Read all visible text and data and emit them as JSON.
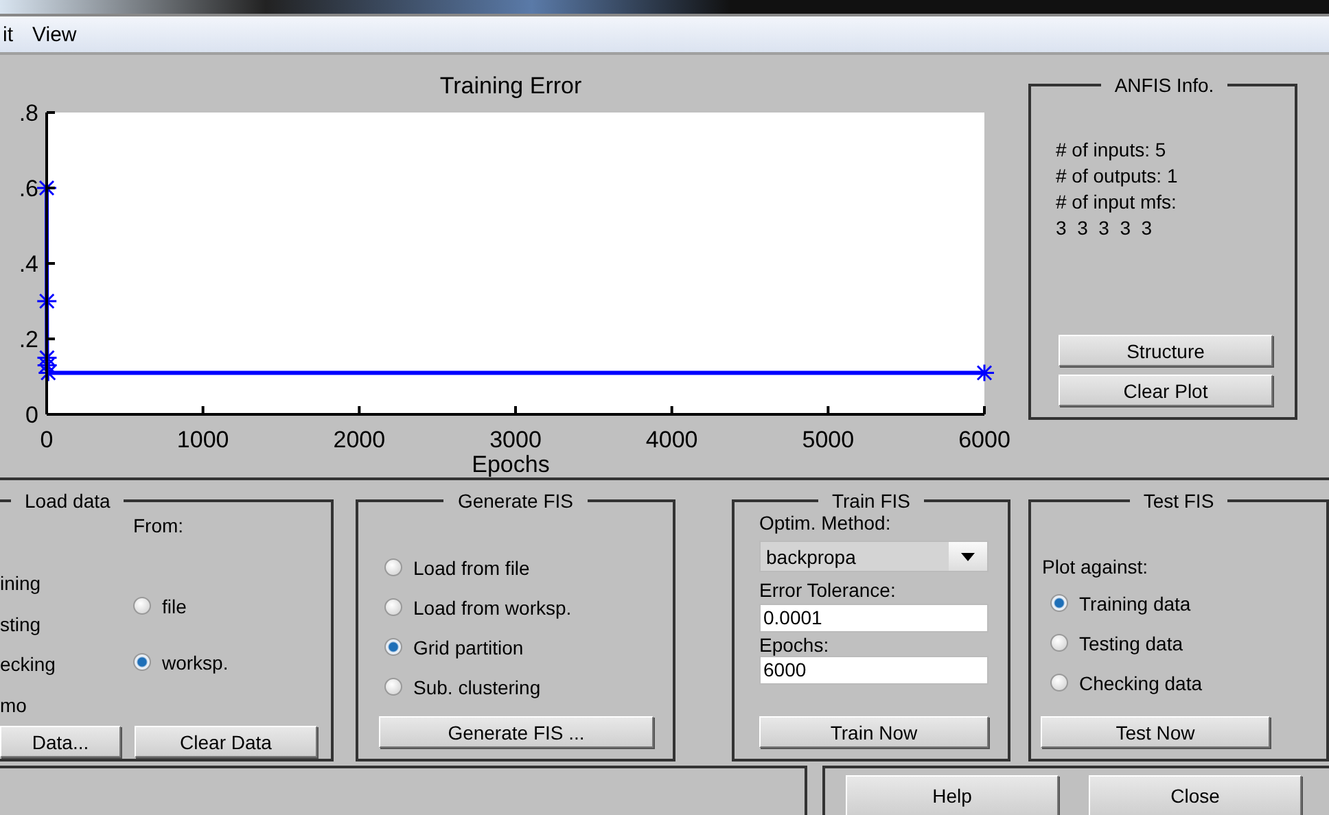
{
  "menu": [
    {
      "label": "it"
    },
    {
      "label": "View"
    }
  ],
  "chart_data": {
    "type": "line",
    "title": "Training Error",
    "xlabel": "Epochs",
    "x": [
      0,
      1,
      2,
      3,
      10,
      6000
    ],
    "series": [
      {
        "color": "#0000ff",
        "marker": "cross",
        "values": [
          0.6,
          0.3,
          0.15,
          0.13,
          0.11,
          0.11
        ]
      }
    ],
    "xlim": [
      0,
      6000
    ],
    "ylim": [
      0,
      0.8
    ],
    "xticks": [
      0,
      1000,
      2000,
      3000,
      4000,
      5000,
      6000
    ],
    "yticks": [
      0,
      {
        "value": 0.2,
        "label": ".2"
      },
      {
        "value": 0.4,
        "label": ".4"
      },
      {
        "value": 0.6,
        "label": ".6"
      },
      {
        "value": 0.8,
        "label": ".8"
      }
    ]
  },
  "anfis_info": {
    "title": "ANFIS Info.",
    "lines": [
      "# of inputs: 5",
      "# of outputs: 1",
      "# of input mfs:",
      "3  3  3  3  3"
    ],
    "buttons": [
      "Structure",
      "Clear Plot"
    ]
  },
  "load_data": {
    "title": "Load data",
    "from_label": "From:",
    "type_options": [
      "ining",
      "sting",
      "ecking",
      "mo"
    ],
    "source_options": [
      {
        "label": "file",
        "selected": false
      },
      {
        "label": "worksp.",
        "selected": true
      }
    ],
    "buttons": [
      "Data...",
      "Clear Data"
    ]
  },
  "generate_fis": {
    "title": "Generate FIS",
    "options": [
      {
        "label": "Load from file",
        "selected": false
      },
      {
        "label": "Load from worksp.",
        "selected": false
      },
      {
        "label": "Grid partition",
        "selected": true
      },
      {
        "label": "Sub. clustering",
        "selected": false
      }
    ],
    "button": "Generate FIS ..."
  },
  "train_fis": {
    "title": "Train FIS",
    "method_label": "Optim. Method:",
    "method": "backpropa",
    "tolerance_label": "Error Tolerance:",
    "tolerance": "0.0001",
    "epochs_label": "Epochs:",
    "epochs": "6000",
    "button": "Train Now"
  },
  "test_fis": {
    "title": "Test FIS",
    "plot_label": "Plot against:",
    "options": [
      {
        "label": "Training data",
        "selected": true
      },
      {
        "label": "Testing data",
        "selected": false
      },
      {
        "label": "Checking data",
        "selected": false
      }
    ],
    "button": "Test Now"
  },
  "footer_buttons": [
    "Help",
    "Close"
  ]
}
